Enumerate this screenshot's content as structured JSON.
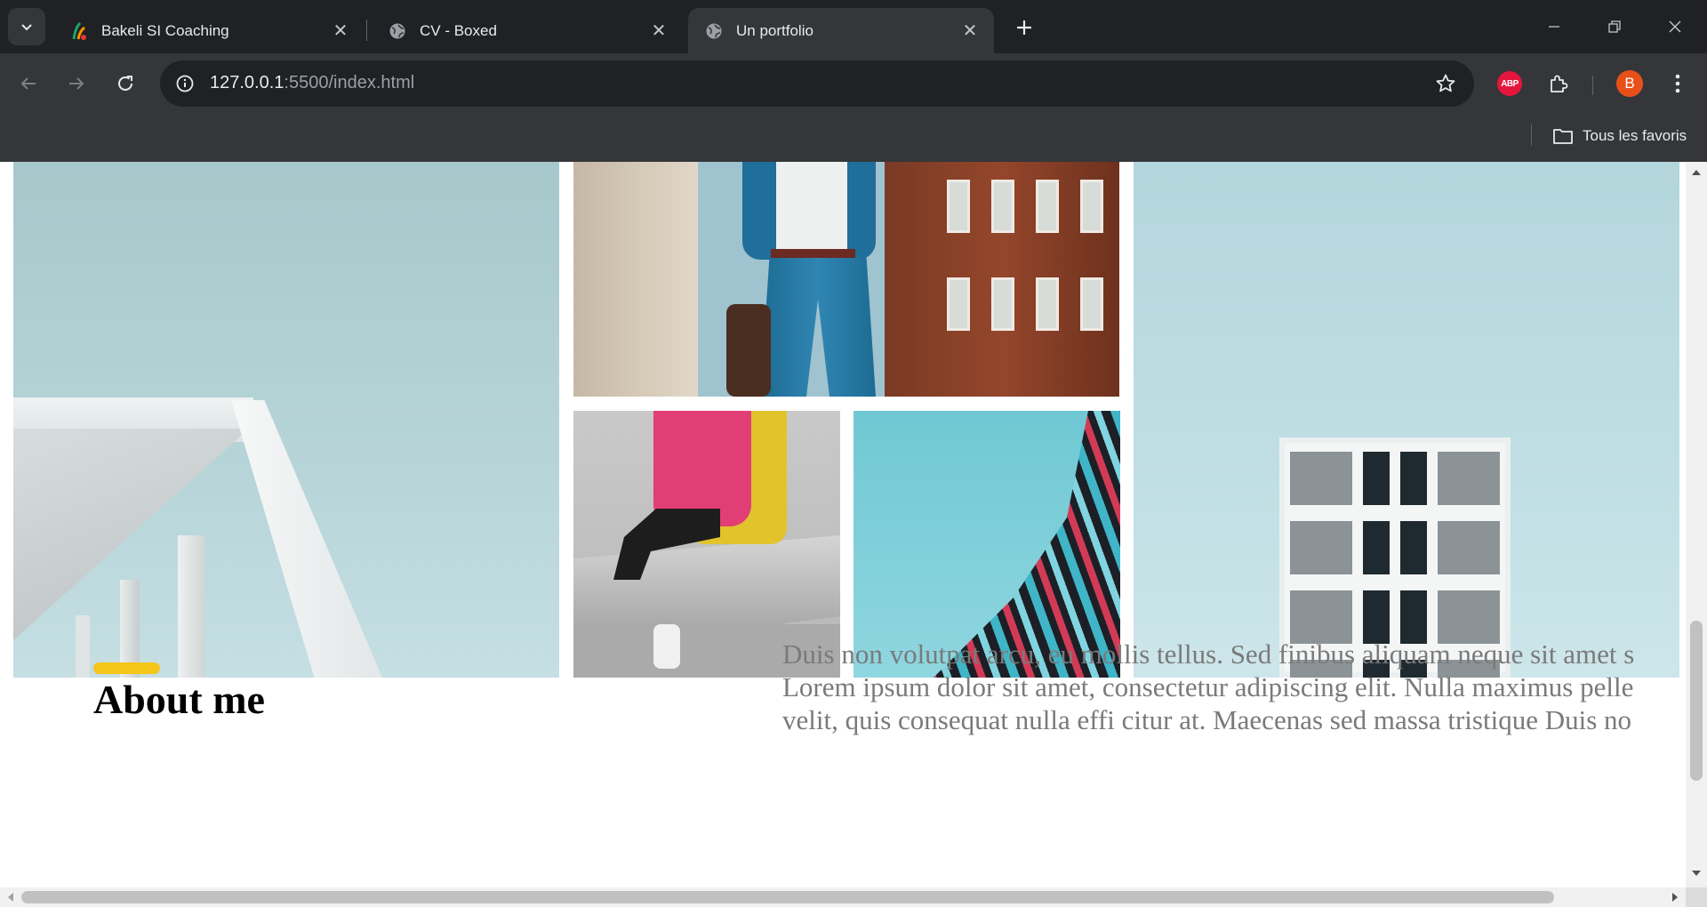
{
  "browser": {
    "tabs": [
      {
        "title": "Bakeli SI Coaching",
        "icon": "bakeli-favicon",
        "active": false
      },
      {
        "title": "CV - Boxed",
        "icon": "globe-icon",
        "active": false
      },
      {
        "title": "Un portfolio",
        "icon": "globe-icon",
        "active": true
      }
    ],
    "url": {
      "host": "127.0.0.1",
      "path": ":5500/index.html"
    },
    "bookmarks": {
      "all_label": "Tous les favoris"
    },
    "extensions": {
      "abp_label": "ABP"
    },
    "profile": {
      "initial": "B",
      "color": "#e8501a"
    }
  },
  "page": {
    "gallery": [
      {
        "name": "architecture-white-roof"
      },
      {
        "name": "man-in-blue-suit"
      },
      {
        "name": "woman-with-pink-backpack"
      },
      {
        "name": "curved-glass-facade"
      },
      {
        "name": "white-building-windows"
      }
    ],
    "about": {
      "accent_color": "#f5c518",
      "title": "About me",
      "lines": [
        "Duis non volutpat arcu, eu mollis tellus. Sed finibus aliquam neque sit amet s",
        "Lorem ipsum dolor sit amet, consectetur adipiscing elit. Nulla maximus pelle",
        "velit, quis consequat nulla effi citur at. Maecenas sed massa tristique Duis no"
      ]
    }
  }
}
